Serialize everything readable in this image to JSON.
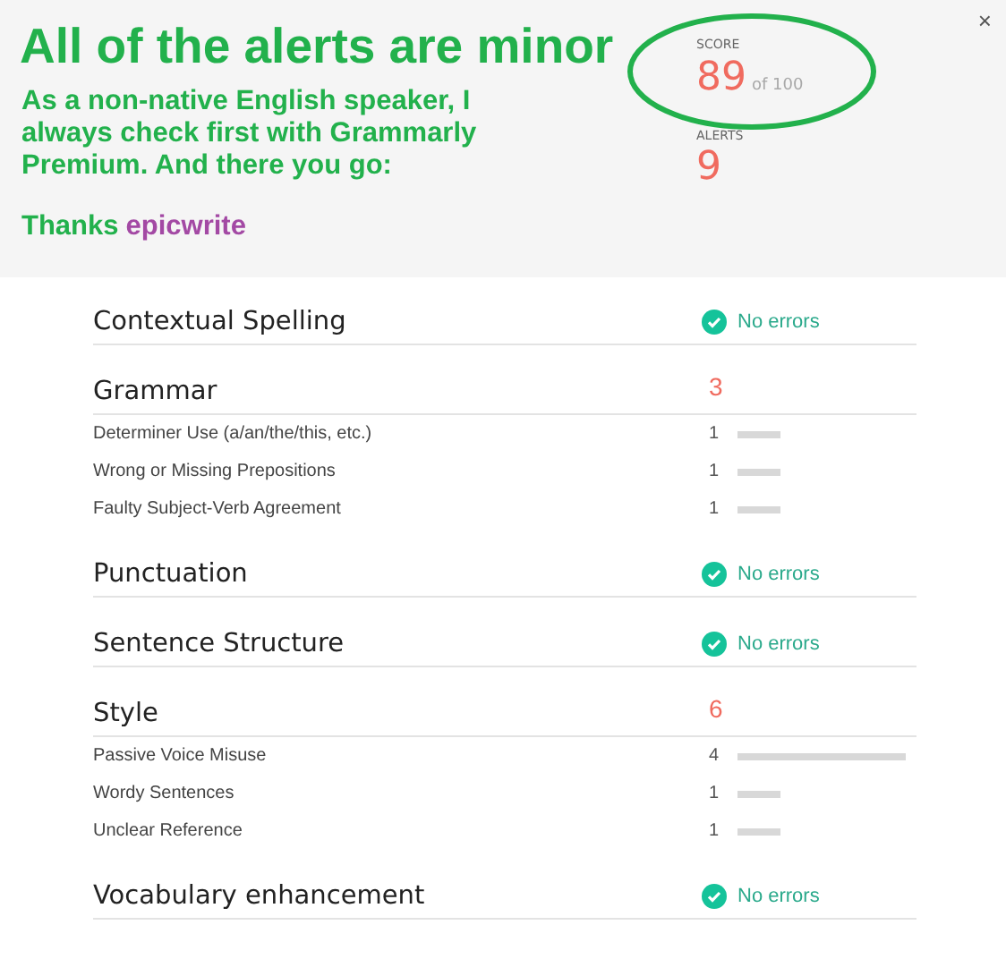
{
  "annotation": {
    "title": "All of the alerts are minor",
    "message": "As a non-native English speaker, I always check first with Grammarly Premium. And there you go:",
    "thanks": "Thanks",
    "thanks_name": "epicwrite"
  },
  "score": {
    "label": "SCORE",
    "value": "89",
    "of": "of 100"
  },
  "alerts": {
    "label": "ALERTS",
    "value": "9"
  },
  "close": "×",
  "sections": [
    {
      "title": "Contextual Spelling",
      "kind": "no_errors",
      "status": "No errors"
    },
    {
      "title": "Grammar",
      "kind": "count",
      "count": "3",
      "items": [
        {
          "name": "Determiner Use (a/an/the/this, etc.)",
          "count": "1"
        },
        {
          "name": "Wrong or Missing Prepositions",
          "count": "1"
        },
        {
          "name": "Faulty Subject-Verb Agreement",
          "count": "1"
        }
      ]
    },
    {
      "title": "Punctuation",
      "kind": "no_errors",
      "status": "No errors"
    },
    {
      "title": "Sentence Structure",
      "kind": "no_errors",
      "status": "No errors"
    },
    {
      "title": "Style",
      "kind": "count",
      "count": "6",
      "items": [
        {
          "name": "Passive Voice Misuse",
          "count": "4"
        },
        {
          "name": "Wordy Sentences",
          "count": "1"
        },
        {
          "name": "Unclear Reference",
          "count": "1"
        }
      ]
    },
    {
      "title": "Vocabulary enhancement",
      "kind": "no_errors",
      "status": "No errors"
    }
  ]
}
